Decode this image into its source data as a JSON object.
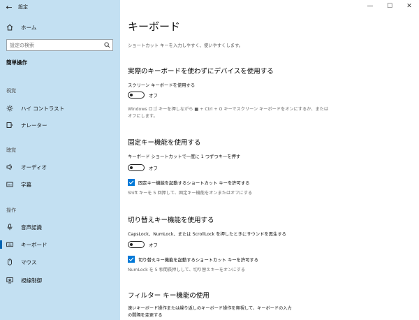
{
  "window": {
    "title": "設定",
    "back_glyph": "←",
    "min_glyph": "—",
    "max_glyph": "☐",
    "close_glyph": "✕"
  },
  "sidebar": {
    "home_label": "ホーム",
    "search_placeholder": "設定の検索",
    "category": "簡単操作",
    "groups": {
      "vision": "視覚",
      "hearing": "聴覚",
      "interaction": "操作"
    },
    "items": {
      "high_contrast": "ハイ コントラスト",
      "narrator": "ナレーター",
      "audio": "オーディオ",
      "captions": "字幕",
      "speech": "音声認識",
      "keyboard": "キーボード",
      "mouse": "マウス",
      "eye_control": "視線制御"
    }
  },
  "main": {
    "title": "キーボード",
    "description": "ショートカット キーを入力しやすく、使いやすくします。",
    "section1": {
      "title": "実際のキーボードを使わずにデバイスを使用する",
      "option_label": "スクリーン キーボードを使用する",
      "toggle_state": "オフ",
      "desc_line1": "Windows ロゴ キーを押しながら ■ + Ctrl + O キーでスクリーン キーボードをオンにするか、または",
      "desc_line2": "オフにします。"
    },
    "section2": {
      "title": "固定キー機能を使用する",
      "option_label": "キーボード ショートカットで一度に 1 つずつキーを押す",
      "toggle_state": "オフ",
      "check_label": "固定キー機能を起動するショートカット キーを許可する",
      "check_desc": "Shift キーを 5 回押して、固定キー機能をオンまたはオフにする"
    },
    "section3": {
      "title": "切り替えキー機能を使用する",
      "option_label": "CapsLock、NumLock、または ScrollLock を押したときにサウンドを再生する",
      "toggle_state": "オフ",
      "check_label": "切り替えキー機能を起動するショートカット キーを許可する",
      "check_desc": "NumLock を 5 秒間長押しして、切り替えキーをオンにする"
    },
    "section4": {
      "title": "フィルター キー機能の使用",
      "desc_line1": "速いキーボード操作または繰り返しのキーボード操作を無視して、キーボードの入力",
      "desc_line2": "の間隔を変更する"
    }
  }
}
